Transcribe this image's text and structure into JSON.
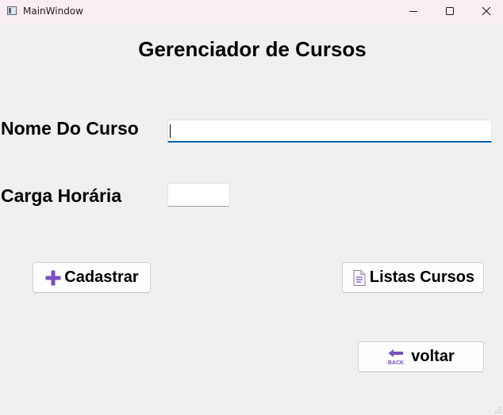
{
  "window": {
    "title": "MainWindow",
    "controls": {
      "minimize": "minimize-icon",
      "maximize": "maximize-icon",
      "close": "close-icon"
    }
  },
  "main": {
    "heading": "Gerenciador de Cursos",
    "nome_label": "Nome Do Curso",
    "nome_value": "",
    "carga_label": "Carga Horária",
    "carga_value": ""
  },
  "buttons": {
    "cadastrar": {
      "label": "Cadastrar",
      "icon": "plus-icon"
    },
    "listas": {
      "label": "Listas Cursos",
      "icon": "document-icon"
    },
    "voltar": {
      "label": "voltar",
      "icon": "back-arrow-icon",
      "icon_text": "BACK"
    }
  },
  "colors": {
    "accent": "#005fb8",
    "icon_purple": "#7b4fc4",
    "background": "#f0f0f0",
    "titlebar": "#f9eef4"
  }
}
